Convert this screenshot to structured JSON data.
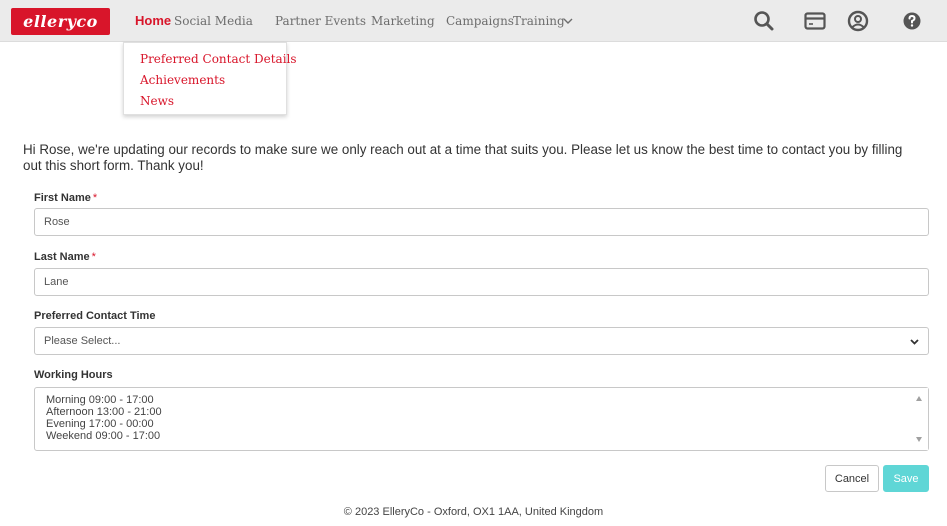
{
  "brand": {
    "logo_text": "elleryco",
    "accent": "#d8152a",
    "save_color": "#5fd6d6"
  },
  "nav": {
    "items": [
      {
        "label": "Home",
        "active": true
      },
      {
        "label": "Social Media"
      },
      {
        "label": "Partner Events"
      },
      {
        "label": "Marketing"
      },
      {
        "label": "Campaigns"
      },
      {
        "label": "Training"
      }
    ],
    "more_icon": "chevron-down-icon",
    "right_icons": [
      "search-icon",
      "card-icon",
      "user-icon",
      "help-icon"
    ]
  },
  "dropdown": {
    "items": [
      {
        "label": "Preferred Contact Details"
      },
      {
        "label": "Achievements"
      },
      {
        "label": "News"
      }
    ]
  },
  "intro": "Hi Rose, we're updating our records to make sure we only reach out at a time that suits you. Please let us know the best time to contact you by filling out this short form. Thank you!",
  "form": {
    "first_name": {
      "label": "First Name",
      "required_mark": "*",
      "value": "Rose"
    },
    "last_name": {
      "label": "Last Name",
      "required_mark": "*",
      "value": "Lane"
    },
    "contact_time": {
      "label": "Preferred Contact Time",
      "value": "Please Select..."
    },
    "working_hours": {
      "label": "Working Hours",
      "options": [
        "Morning 09:00 - 17:00",
        "Afternoon 13:00 - 21:00",
        "Evening 17:00 - 00:00",
        "Weekend 09:00 - 17:00"
      ]
    },
    "cancel_label": "Cancel",
    "save_label": "Save"
  },
  "footer": "© 2023 ElleryCo - Oxford, OX1 1AA, United Kingdom"
}
